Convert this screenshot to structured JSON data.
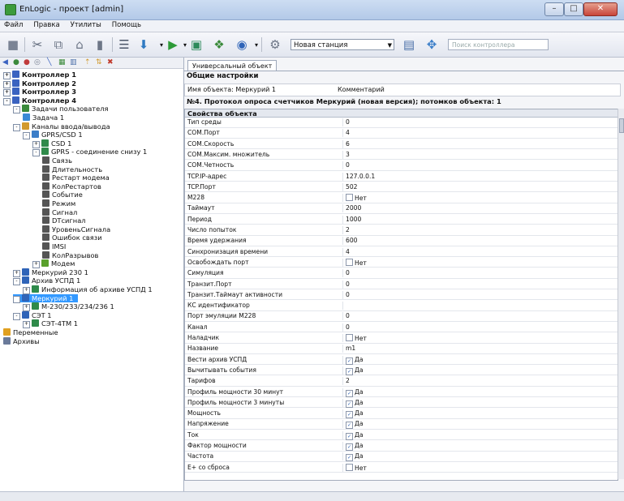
{
  "window": {
    "title": "EnLogic - проект [admin]"
  },
  "menu": [
    "Файл",
    "Правка",
    "Утилиты",
    "Помощь"
  ],
  "toolbar": {
    "station_select": "Новая станция",
    "search_placeholder": "Поиск контроллера"
  },
  "tree": [
    {
      "label": "Контроллер 1",
      "level": 0,
      "exp": "+",
      "icon": "controller",
      "bold": true
    },
    {
      "label": "Контроллер 2",
      "level": 0,
      "exp": "+",
      "icon": "controller",
      "bold": true
    },
    {
      "label": "Контроллер 3",
      "level": 0,
      "exp": "+",
      "icon": "controller",
      "bold": true
    },
    {
      "label": "Контроллер 4",
      "level": 0,
      "exp": "-",
      "icon": "controller",
      "bold": true
    },
    {
      "label": "Задачи пользователя",
      "level": 1,
      "exp": "-",
      "icon": "tasks"
    },
    {
      "label": "Задача 1",
      "level": 2,
      "exp": "",
      "icon": "task"
    },
    {
      "label": "Каналы ввода/вывода",
      "level": 1,
      "exp": "-",
      "icon": "channels"
    },
    {
      "label": "GPRS/CSD 1",
      "level": 2,
      "exp": "-",
      "icon": "modem"
    },
    {
      "label": "CSD 1",
      "level": 3,
      "exp": "+",
      "icon": "csd"
    },
    {
      "label": "GPRS - соединение снизу 1",
      "level": 3,
      "exp": "-",
      "icon": "csd"
    },
    {
      "label": "Связь",
      "level": 4,
      "exp": "",
      "icon": "signal"
    },
    {
      "label": "Длительность",
      "level": 4,
      "exp": "",
      "icon": "wave"
    },
    {
      "label": "Рестарт модема",
      "level": 4,
      "exp": "",
      "icon": "signal"
    },
    {
      "label": "КолРестартов",
      "level": 4,
      "exp": "",
      "icon": "wave"
    },
    {
      "label": "Событие",
      "level": 4,
      "exp": "",
      "icon": "str"
    },
    {
      "label": "Режим",
      "level": 4,
      "exp": "",
      "icon": "wave"
    },
    {
      "label": "Сигнал",
      "level": 4,
      "exp": "",
      "icon": "str"
    },
    {
      "label": "DTсигнал",
      "level": 4,
      "exp": "",
      "icon": "dt"
    },
    {
      "label": "УровеньСигнала",
      "level": 4,
      "exp": "",
      "icon": "wave"
    },
    {
      "label": "Ошибок связи",
      "level": 4,
      "exp": "",
      "icon": "wave"
    },
    {
      "label": "IMSI",
      "level": 4,
      "exp": "",
      "icon": "str"
    },
    {
      "label": "КолРазрывов",
      "level": 4,
      "exp": "",
      "icon": "wave"
    },
    {
      "label": "Модем",
      "level": 3,
      "exp": "+",
      "icon": "modem2"
    },
    {
      "label": "Меркурий 230 1",
      "level": 1,
      "exp": "+",
      "icon": "meter"
    },
    {
      "label": "Архив УСПД 1",
      "level": 1,
      "exp": "-",
      "icon": "meter"
    },
    {
      "label": "Информация об архиве УСПД 1",
      "level": 2,
      "exp": "+",
      "icon": "csd"
    },
    {
      "label": "Меркурий 1",
      "level": 1,
      "exp": "-",
      "icon": "meter",
      "selected": true
    },
    {
      "label": "M-230/233/234/236 1",
      "level": 2,
      "exp": "+",
      "icon": "csd"
    },
    {
      "label": "СЭТ 1",
      "level": 1,
      "exp": "-",
      "icon": "meter"
    },
    {
      "label": "СЭТ-4ТМ 1",
      "level": 2,
      "exp": "+",
      "icon": "csd"
    },
    {
      "label": "Переменные",
      "level": 0,
      "exp": "",
      "icon": "vars"
    },
    {
      "label": "Архивы",
      "level": 0,
      "exp": "",
      "icon": "archive"
    }
  ],
  "tab": {
    "label": "Универсальный объект"
  },
  "general": {
    "header": "Общие настройки",
    "name_label": "Имя объекта: Меркурий 1",
    "comment_label": "Комментарий"
  },
  "headline": "№4. Протокол опроса счетчиков Меркурий (новая версия); потомков объекта: 1",
  "props_header": "Свойства объекта",
  "properties": [
    {
      "k": "Тип среды",
      "v": "0"
    },
    {
      "k": "COM.Порт",
      "v": "4"
    },
    {
      "k": "COM.Скорость",
      "v": "6"
    },
    {
      "k": "COM.Максим. множитель",
      "v": "3"
    },
    {
      "k": "COM.Четность",
      "v": "0"
    },
    {
      "k": "TCP.IP-адрес",
      "v": "127.0.0.1"
    },
    {
      "k": "TCP.Порт",
      "v": "502"
    },
    {
      "k": "M228",
      "v": "Нет",
      "cb": false
    },
    {
      "k": "Таймаут",
      "v": "2000"
    },
    {
      "k": "Период",
      "v": "1000"
    },
    {
      "k": "Число попыток",
      "v": "2"
    },
    {
      "k": "Время удержания",
      "v": "600"
    },
    {
      "k": "Синхронизация времени",
      "v": "4"
    },
    {
      "k": "Освобождать порт",
      "v": "Нет",
      "cb": false
    },
    {
      "k": "Симуляция",
      "v": "0"
    },
    {
      "k": "Транзит.Порт",
      "v": "0"
    },
    {
      "k": "Транзит.Таймаут активности",
      "v": "0"
    },
    {
      "k": "КС идентификатор",
      "v": ""
    },
    {
      "k": "Порт эмуляции M228",
      "v": "0"
    },
    {
      "k": "Канал",
      "v": "0"
    },
    {
      "k": "Наладчик",
      "v": "Нет",
      "cb": false
    },
    {
      "k": "Название",
      "v": "m1"
    },
    {
      "k": "Вести архив УСПД",
      "v": "Да",
      "cb": true
    },
    {
      "k": "Вычитывать события",
      "v": "Да",
      "cb": true
    },
    {
      "k": "Тарифов",
      "v": "2"
    },
    {
      "k": "Профиль мощности 30 минут",
      "v": "Да",
      "cb": true
    },
    {
      "k": "Профиль мощности 3 минуты",
      "v": "Да",
      "cb": true
    },
    {
      "k": "Мощность",
      "v": "Да",
      "cb": true
    },
    {
      "k": "Напряжение",
      "v": "Да",
      "cb": true
    },
    {
      "k": "Ток",
      "v": "Да",
      "cb": true
    },
    {
      "k": "Фактор мощности",
      "v": "Да",
      "cb": true
    },
    {
      "k": "Частота",
      "v": "Да",
      "cb": true
    },
    {
      "k": "Е+ со сброса",
      "v": "Нет",
      "cb": false
    }
  ]
}
